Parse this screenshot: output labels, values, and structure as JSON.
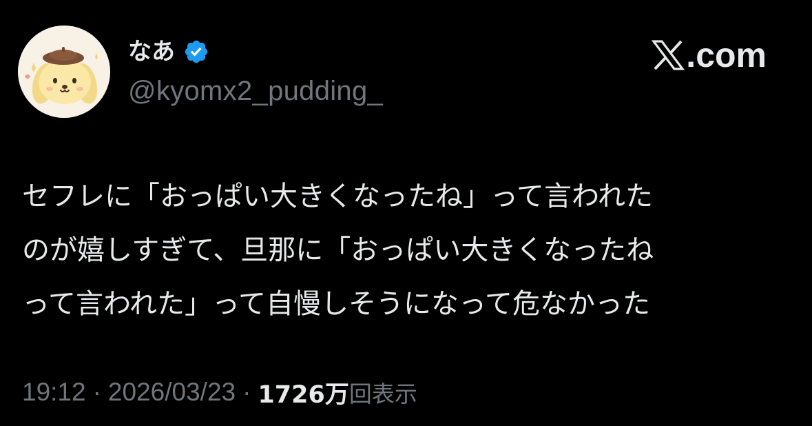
{
  "author": {
    "display_name": "なあ",
    "handle": "@kyomx2_pudding_",
    "verified": true,
    "avatar_icon": "pudding-dog-avatar",
    "badge_color": "#1d9bf0"
  },
  "brand": {
    "logo_icon": "x-logo-icon",
    "text": ".com"
  },
  "tweet": {
    "lines": [
      "セフレに「おっぱい大きくなったね」って言われた",
      "のが嬉しすぎて、旦那に「おっぱい大きくなったね",
      "って言われた」って自慢しそうになって危なかった"
    ]
  },
  "meta": {
    "time": "19:12",
    "date": "2026/03/23",
    "separator": "·",
    "views_count": "1726万",
    "views_label": "回表示"
  },
  "colors": {
    "background": "#000000",
    "primary_text": "#e7e9ea",
    "secondary_text": "#71767b"
  }
}
